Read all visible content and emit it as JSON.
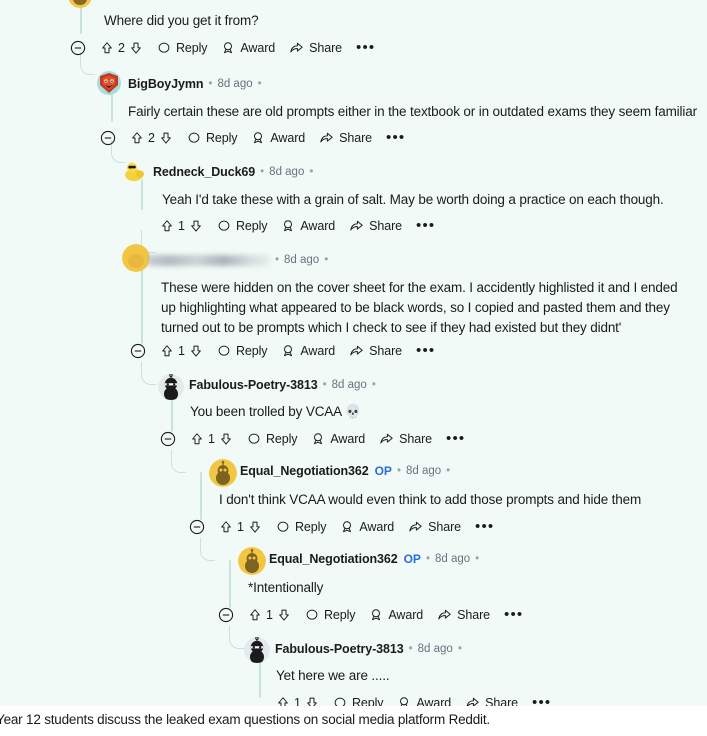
{
  "page": {
    "platform": "Reddit",
    "background_color": "#f1faf6",
    "thread_line_color": "#c6e3de",
    "op_badge_color": "#2a6fd6"
  },
  "caption": {
    "text": "Year 12 students discuss the leaked exam questions on social media platform Reddit."
  },
  "action_labels": {
    "reply": "Reply",
    "award": "Award",
    "share": "Share",
    "more": "•••"
  },
  "comments": [
    {
      "id": "c1",
      "author": null,
      "author_visible": false,
      "body": "Where did you get it from?",
      "score": "2",
      "timestamp": "",
      "has_collapse": true,
      "is_op": false
    },
    {
      "id": "c2",
      "author": "BigBoyJymn",
      "timestamp": "8d ago",
      "body": "Fairly certain these are old prompts either in the textbook or in outdated exams they seem familiar",
      "score": "2",
      "has_collapse": true,
      "is_op": false,
      "avatar": "bigboyjymn-avatar"
    },
    {
      "id": "c3",
      "author": "Redneck_Duck69",
      "timestamp": "8d ago",
      "body": "Yeah I'd take these with a grain of salt. May be worth doing a practice on each though.",
      "score": "1",
      "has_collapse": false,
      "is_op": false,
      "avatar": "redneck-duck-avatar"
    },
    {
      "id": "c4",
      "author": null,
      "author_redacted": true,
      "timestamp": "8d ago",
      "body": "These were hidden on the cover sheet for the exam. I accidently highlisted it and I ended up highlighting what appeared to be black words, so I copied and pasted them and they turned out to be prompts which I check to see if they had existed but they didnt'",
      "score": "1",
      "has_collapse": true,
      "is_op": false,
      "avatar": "redacted-user-avatar"
    },
    {
      "id": "c5",
      "author": "Fabulous-Poetry-3813",
      "timestamp": "8d ago",
      "body": "You been trolled by VCAA 💀",
      "score": "1",
      "has_collapse": true,
      "is_op": false,
      "avatar": "fabulous-poetry-avatar"
    },
    {
      "id": "c6",
      "author": "Equal_Negotiation362",
      "op_label": "OP",
      "timestamp": "8d ago",
      "body": "I don't think VCAA would even think to add those prompts and hide them",
      "score": "1",
      "has_collapse": true,
      "is_op": true,
      "avatar": "equal-negotiation-avatar"
    },
    {
      "id": "c7",
      "author": "Equal_Negotiation362",
      "op_label": "OP",
      "timestamp": "8d ago",
      "body": "*Intentionally",
      "score": "1",
      "has_collapse": true,
      "is_op": true,
      "avatar": "equal-negotiation-avatar"
    },
    {
      "id": "c8",
      "author": "Fabulous-Poetry-3813",
      "timestamp": "8d ago",
      "body": "Yet here we are .....",
      "score": "1",
      "has_collapse": false,
      "is_op": false,
      "avatar": "fabulous-poetry-avatar"
    }
  ]
}
